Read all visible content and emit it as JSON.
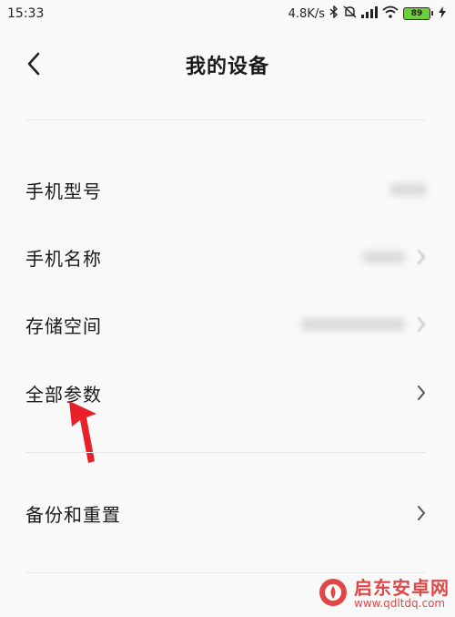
{
  "status_bar": {
    "time": "15:33",
    "network_speed": "4.8K/s",
    "battery_level": "89",
    "icons": [
      "bluetooth-icon",
      "mute-icon",
      "signal-icon",
      "wifi-icon",
      "battery-icon",
      "charging-icon"
    ]
  },
  "header": {
    "title": "我的设备",
    "back_icon": "chevron-left-icon"
  },
  "rows": [
    {
      "label": "手机型号",
      "value_blurred": true,
      "has_chevron": false
    },
    {
      "label": "手机名称",
      "value_blurred": true,
      "has_chevron": true
    },
    {
      "label": "存储空间",
      "value_blurred": true,
      "has_chevron": true
    },
    {
      "label": "全部参数",
      "value_blurred": false,
      "has_chevron": true
    },
    {
      "label": "备份和重置",
      "value_blurred": false,
      "has_chevron": true
    }
  ],
  "annotation": {
    "icon": "red-arrow-icon",
    "color": "#e8202a"
  },
  "watermark": {
    "brand": "启东安卓网",
    "url": "www.qdltdq.com",
    "color": "#e04848"
  }
}
